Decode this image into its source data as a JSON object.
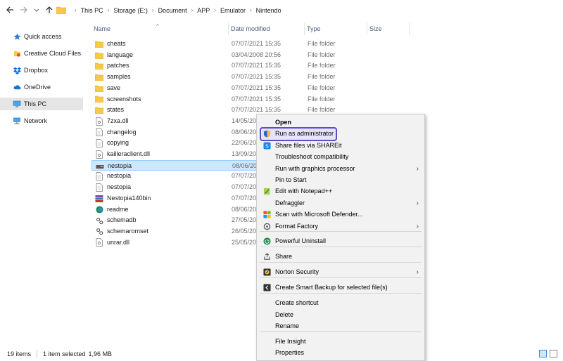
{
  "address": {
    "crumbs": [
      "This PC",
      "Storage (E:)",
      "Document",
      "APP",
      "Emulator",
      "Nintendo"
    ]
  },
  "nav": {
    "items": [
      {
        "label": "Quick access",
        "icon": "star-icon"
      },
      {
        "label": "Creative Cloud Files",
        "icon": "creative-cloud-icon"
      },
      {
        "label": "Dropbox",
        "icon": "dropbox-icon"
      },
      {
        "label": "OneDrive",
        "icon": "onedrive-icon"
      },
      {
        "label": "This PC",
        "icon": "computer-icon"
      },
      {
        "label": "Network",
        "icon": "network-icon"
      }
    ]
  },
  "columns": {
    "name": "Name",
    "date": "Date modified",
    "type": "Type",
    "size": "Size"
  },
  "files": [
    {
      "name": "cheats",
      "date": "07/07/2021 15:35",
      "type": "File folder",
      "icon": "folder-icon"
    },
    {
      "name": "language",
      "date": "03/04/2008 20:56",
      "type": "File folder",
      "icon": "folder-icon"
    },
    {
      "name": "patches",
      "date": "07/07/2021 15:35",
      "type": "File folder",
      "icon": "folder-icon"
    },
    {
      "name": "samples",
      "date": "07/07/2021 15:35",
      "type": "File folder",
      "icon": "folder-icon"
    },
    {
      "name": "save",
      "date": "07/07/2021 15:35",
      "type": "File folder",
      "icon": "folder-icon"
    },
    {
      "name": "screenshots",
      "date": "07/07/2021 15:35",
      "type": "File folder",
      "icon": "folder-icon"
    },
    {
      "name": "states",
      "date": "07/07/2021 15:35",
      "type": "File folder",
      "icon": "folder-icon"
    },
    {
      "name": "7zxa.dll",
      "date": "14/05/20",
      "type": "",
      "icon": "dll-file-icon"
    },
    {
      "name": "changelog",
      "date": "08/06/20",
      "type": "",
      "icon": "document-icon"
    },
    {
      "name": "copying",
      "date": "22/06/20",
      "type": "",
      "icon": "document-icon"
    },
    {
      "name": "kailleraclient.dll",
      "date": "13/09/20",
      "type": "",
      "icon": "dll-file-icon"
    },
    {
      "name": "nestopia",
      "date": "08/06/20",
      "type": "",
      "icon": "nestopia-app-icon"
    },
    {
      "name": "nestopia",
      "date": "07/07/20",
      "type": "",
      "icon": "document-icon"
    },
    {
      "name": "nestopia",
      "date": "07/07/20",
      "type": "",
      "icon": "document-icon"
    },
    {
      "name": "Nestopia140bin",
      "date": "07/07/20",
      "type": "",
      "icon": "archive-icon"
    },
    {
      "name": "readme",
      "date": "08/06/20",
      "type": "",
      "icon": "edge-icon"
    },
    {
      "name": "schemadb",
      "date": "27/05/20",
      "type": "",
      "icon": "settings-file-icon"
    },
    {
      "name": "schemaromset",
      "date": "26/05/20",
      "type": "",
      "icon": "settings-file-icon"
    },
    {
      "name": "unrar.dll",
      "date": "25/05/20",
      "type": "",
      "icon": "dll-file-icon"
    }
  ],
  "selected_index": 11,
  "status": {
    "items": "19 items",
    "selected": "1 item selected",
    "size": "1,96 MB"
  },
  "context_menu": {
    "items": [
      {
        "label": "Open",
        "icon": "",
        "bold": true,
        "submenu": false
      },
      {
        "label": "Run as administrator",
        "icon": "uac-shield-icon",
        "bold": false,
        "submenu": false
      },
      {
        "label": "Share files via SHAREit",
        "icon": "shareit-icon",
        "bold": false,
        "submenu": false
      },
      {
        "label": "Troubleshoot compatibility",
        "icon": "",
        "bold": false,
        "submenu": false
      },
      {
        "label": "Run with graphics processor",
        "icon": "",
        "bold": false,
        "submenu": true
      },
      {
        "label": "Pin to Start",
        "icon": "",
        "bold": false,
        "submenu": false
      },
      {
        "label": "Edit with Notepad++",
        "icon": "notepadpp-icon",
        "bold": false,
        "submenu": false
      },
      {
        "label": "Defraggler",
        "icon": "",
        "bold": false,
        "submenu": true
      },
      {
        "label": "Scan with Microsoft Defender...",
        "icon": "defender-icon",
        "bold": false,
        "submenu": false
      },
      {
        "label": "Format Factory",
        "icon": "format-factory-icon",
        "bold": false,
        "submenu": true
      },
      {
        "label": "Powerful Uninstall",
        "icon": "uninstall-icon",
        "bold": false,
        "submenu": false
      },
      {
        "label": "Share",
        "icon": "share-icon",
        "bold": false,
        "submenu": false
      },
      {
        "label": "Norton Security",
        "icon": "norton-icon",
        "bold": false,
        "submenu": true
      },
      {
        "label": "Create Smart Backup for selected file(s)",
        "icon": "backup-icon",
        "bold": false,
        "submenu": false
      },
      {
        "label": "Create shortcut",
        "icon": "",
        "bold": false,
        "submenu": false
      },
      {
        "label": "Delete",
        "icon": "",
        "bold": false,
        "submenu": false
      },
      {
        "label": "Rename",
        "icon": "",
        "bold": false,
        "submenu": false
      },
      {
        "label": "File Insight",
        "icon": "",
        "bold": false,
        "submenu": false
      },
      {
        "label": "Properties",
        "icon": "",
        "bold": false,
        "submenu": false
      }
    ]
  },
  "colors": {
    "selection": "#cce8ff",
    "highlight_border": "#5b4fc4",
    "folder": "#f7c948"
  }
}
